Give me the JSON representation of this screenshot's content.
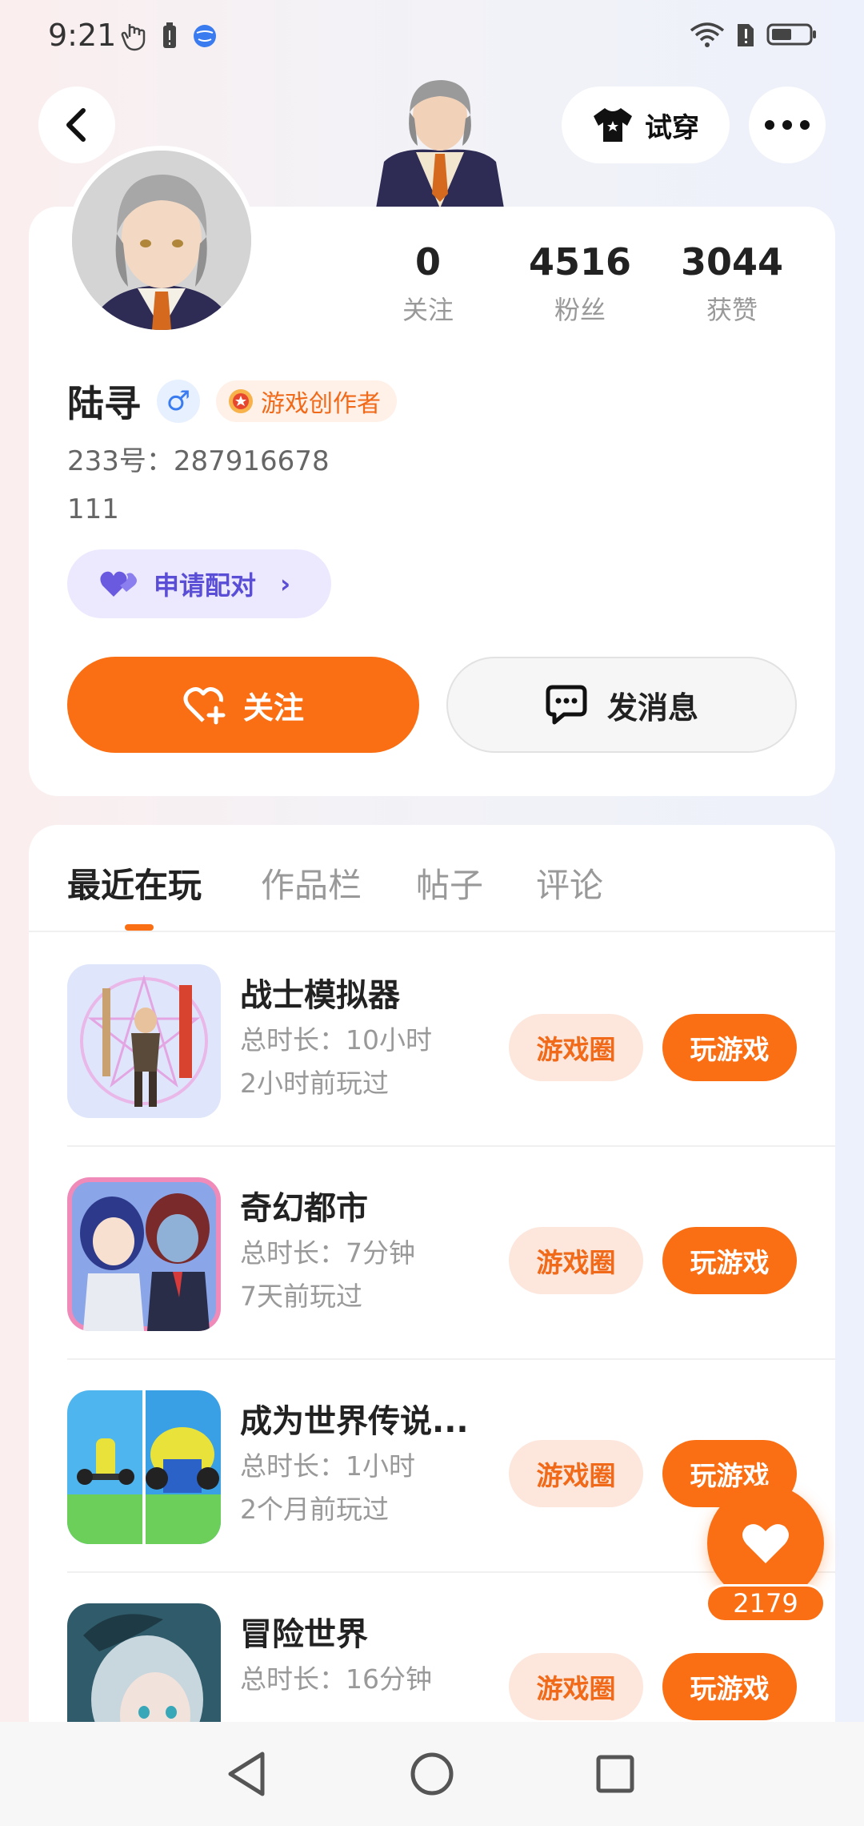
{
  "status_bar": {
    "time": "9:21"
  },
  "header": {
    "try_on_label": "试穿"
  },
  "profile": {
    "name": "陆寻",
    "gender_symbol": "♂",
    "creator_badge": "游戏创作者",
    "id_line": "233号：287916678",
    "signature": "111",
    "pair_label": "申请配对",
    "stats": [
      {
        "value": "0",
        "label": "关注"
      },
      {
        "value": "4516",
        "label": "粉丝"
      },
      {
        "value": "3044",
        "label": "获赞"
      }
    ],
    "follow_label": "关注",
    "message_label": "发消息"
  },
  "tabs": [
    {
      "label": "最近在玩",
      "active": true
    },
    {
      "label": "作品栏",
      "active": false
    },
    {
      "label": "帖子",
      "active": false
    },
    {
      "label": "评论",
      "active": false
    }
  ],
  "games": [
    {
      "title": "战士模拟器",
      "duration": "总时长：10小时",
      "last_played": "2小时前玩过",
      "circle_label": "游戏圈",
      "play_label": "玩游戏"
    },
    {
      "title": "奇幻都市",
      "duration": "总时长：7分钟",
      "last_played": "7天前玩过",
      "circle_label": "游戏圈",
      "play_label": "玩游戏"
    },
    {
      "title": "成为世界传说...",
      "duration": "总时长：1小时",
      "last_played": "2个月前玩过",
      "circle_label": "游戏圈",
      "play_label": "玩游戏"
    },
    {
      "title": "冒险世界",
      "duration": "总时长：16分钟",
      "last_played": "",
      "circle_label": "游戏圈",
      "play_label": "玩游戏"
    }
  ],
  "like_fab": {
    "count": "2179"
  },
  "colors": {
    "accent": "#fb6f14",
    "pair": "#5b4ed6"
  }
}
